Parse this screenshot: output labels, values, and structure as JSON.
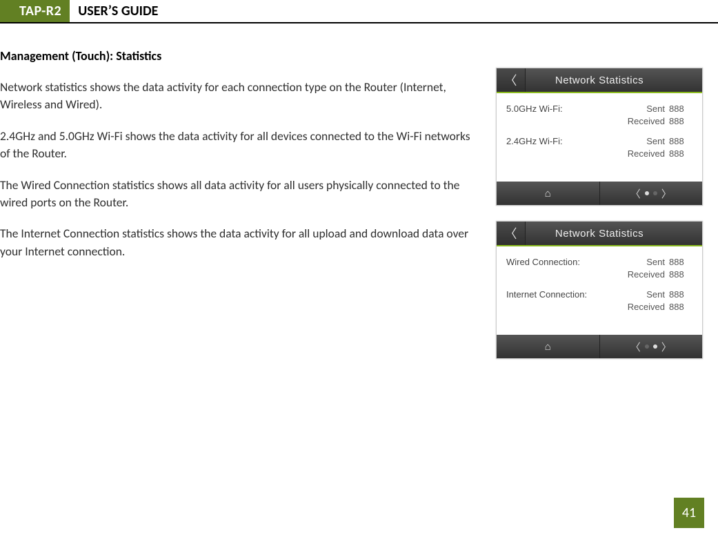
{
  "header": {
    "model": "TAP-R2",
    "title": "USER’S GUIDE"
  },
  "section_heading": "Management (Touch): Statistics",
  "paragraphs": {
    "p1": "Network statistics shows the data activity for each connection type on the Router (Internet, Wireless and Wired).",
    "p2": "2.4GHz and 5.0GHz Wi-Fi shows the data activity for all devices connected to the Wi-Fi networks of the Router.",
    "p3": "The Wired Connection statistics shows all data activity for all users physically connected to the wired ports on the Router.",
    "p4": "The Internet Connection statistics shows the data activity for all upload and download data over your Internet connection."
  },
  "device_common": {
    "title": "Network Statistics",
    "sent_label": "Sent",
    "recv_label": "Received"
  },
  "device1": {
    "row1": {
      "name": "5.0GHz Wi-Fi:",
      "sent": "888",
      "recv": "888"
    },
    "row2": {
      "name": "2.4GHz Wi-Fi:",
      "sent": "888",
      "recv": "888"
    }
  },
  "device2": {
    "row1": {
      "name": "Wired Connection:",
      "sent": "888",
      "recv": "888"
    },
    "row2": {
      "name": "Internet Connection:",
      "sent": "888",
      "recv": "888"
    }
  },
  "page_number": "41"
}
